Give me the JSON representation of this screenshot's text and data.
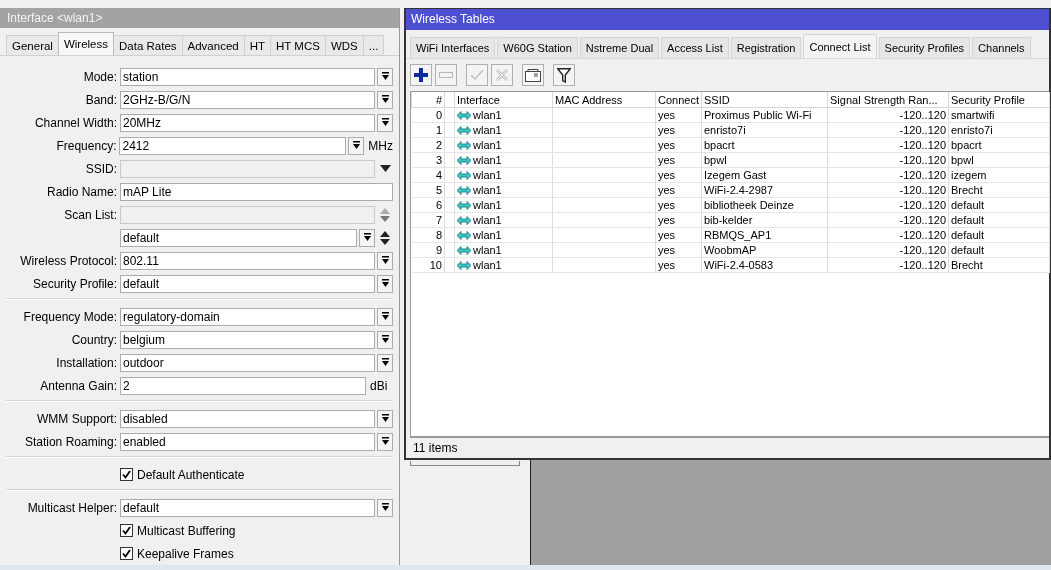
{
  "interface_window": {
    "title": "Interface <wlan1>",
    "tabs": [
      {
        "label": "General",
        "selected": false
      },
      {
        "label": "Wireless",
        "selected": true
      },
      {
        "label": "Data Rates",
        "selected": false
      },
      {
        "label": "Advanced",
        "selected": false
      },
      {
        "label": "HT",
        "selected": false
      },
      {
        "label": "HT MCS",
        "selected": false
      },
      {
        "label": "WDS",
        "selected": false
      },
      {
        "label": "...",
        "selected": false
      }
    ],
    "groups": [
      [
        {
          "kind": "select",
          "label": "Mode:",
          "value": "station"
        },
        {
          "kind": "select",
          "label": "Band:",
          "value": "2GHz-B/G/N"
        },
        {
          "kind": "select",
          "label": "Channel Width:",
          "value": "20MHz"
        },
        {
          "kind": "select",
          "label": "Frequency:",
          "value": "2412",
          "unit": "MHz"
        },
        {
          "kind": "select-disabled",
          "label": "SSID:"
        },
        {
          "kind": "text",
          "label": "Radio Name:",
          "value": "mAP Lite"
        },
        {
          "kind": "list-disabled",
          "label": "Scan List:"
        },
        {
          "kind": "list-select",
          "value": "default"
        },
        {
          "kind": "select",
          "label": "Wireless Protocol:",
          "value": "802.11"
        },
        {
          "kind": "select",
          "label": "Security Profile:",
          "value": "default"
        }
      ],
      [
        {
          "kind": "select",
          "label": "Frequency Mode:",
          "value": "regulatory-domain"
        },
        {
          "kind": "select",
          "label": "Country:",
          "value": "belgium"
        },
        {
          "kind": "select",
          "label": "Installation:",
          "value": "outdoor"
        },
        {
          "kind": "text",
          "label": "Antenna Gain:",
          "value": "2",
          "unit": "dBi"
        }
      ],
      [
        {
          "kind": "select",
          "label": "WMM Support:",
          "value": "disabled"
        },
        {
          "kind": "select",
          "label": "Station Roaming:",
          "value": "enabled"
        }
      ],
      [
        {
          "kind": "checkbox",
          "label": "Default Authenticate",
          "checked": true
        }
      ],
      [
        {
          "kind": "select",
          "label": "Multicast Helper:",
          "value": "default"
        },
        {
          "kind": "checkbox",
          "label": "Multicast Buffering",
          "checked": true
        },
        {
          "kind": "checkbox",
          "label": "Keepalive Frames",
          "checked": true
        }
      ]
    ]
  },
  "wireless_tables": {
    "title": "Wireless Tables",
    "tabs": [
      {
        "label": "WiFi Interfaces",
        "selected": false
      },
      {
        "label": "W60G Station",
        "selected": false
      },
      {
        "label": "Nstreme Dual",
        "selected": false
      },
      {
        "label": "Access List",
        "selected": false
      },
      {
        "label": "Registration",
        "selected": false
      },
      {
        "label": "Connect List",
        "selected": true
      },
      {
        "label": "Security Profiles",
        "selected": false
      },
      {
        "label": "Channels",
        "selected": false
      }
    ],
    "toolbar": [
      {
        "kind": "add",
        "disabled": false
      },
      {
        "kind": "remove",
        "disabled": true
      },
      {
        "kind": "enable",
        "disabled": true
      },
      {
        "kind": "disable",
        "disabled": true
      },
      {
        "kind": "comment",
        "disabled": false
      },
      {
        "kind": "filter",
        "disabled": false
      }
    ],
    "table": {
      "columns": [
        "#",
        "Interface",
        "MAC Address",
        "Connect",
        "SSID",
        "Signal Strength Ran...",
        "Security Profile"
      ],
      "rows": [
        {
          "num": "0",
          "interface": "wlan1",
          "connect": "yes",
          "ssid": "Proximus Public Wi-Fi",
          "signal": "-120..120",
          "security_profile": "smartwifi"
        },
        {
          "num": "1",
          "interface": "wlan1",
          "connect": "yes",
          "ssid": "enristo7i",
          "signal": "-120..120",
          "security_profile": "enristo7i"
        },
        {
          "num": "2",
          "interface": "wlan1",
          "connect": "yes",
          "ssid": "bpacrt",
          "signal": "-120..120",
          "security_profile": "bpacrt"
        },
        {
          "num": "3",
          "interface": "wlan1",
          "connect": "yes",
          "ssid": "bpwl",
          "signal": "-120..120",
          "security_profile": "bpwl"
        },
        {
          "num": "4",
          "interface": "wlan1",
          "connect": "yes",
          "ssid": "Izegem Gast",
          "signal": "-120..120",
          "security_profile": "izegem"
        },
        {
          "num": "5",
          "interface": "wlan1",
          "connect": "yes",
          "ssid": "WiFi-2.4-2987",
          "signal": "-120..120",
          "security_profile": "Brecht"
        },
        {
          "num": "6",
          "interface": "wlan1",
          "connect": "yes",
          "ssid": "bibliotheek Deinze",
          "signal": "-120..120",
          "security_profile": "default"
        },
        {
          "num": "7",
          "interface": "wlan1",
          "connect": "yes",
          "ssid": "bib-kelder",
          "signal": "-120..120",
          "security_profile": "default"
        },
        {
          "num": "8",
          "interface": "wlan1",
          "connect": "yes",
          "ssid": "RBMQS_AP1",
          "signal": "-120..120",
          "security_profile": "default"
        },
        {
          "num": "9",
          "interface": "wlan1",
          "connect": "yes",
          "ssid": "WoobmAP",
          "signal": "-120..120",
          "security_profile": "default"
        },
        {
          "num": "10",
          "interface": "wlan1",
          "connect": "yes",
          "ssid": "WiFi-2.4-0583",
          "signal": "-120..120",
          "security_profile": "Brecht"
        }
      ]
    },
    "status_bar": "11 items"
  }
}
